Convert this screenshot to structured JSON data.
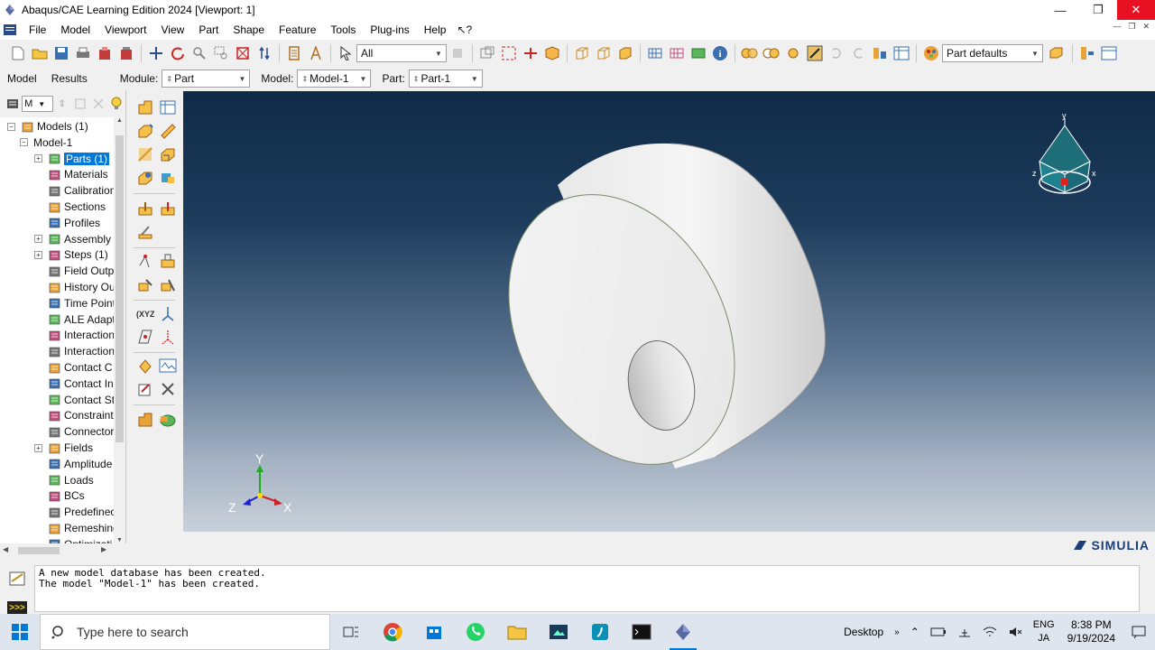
{
  "window": {
    "title": "Abaqus/CAE Learning Edition 2024 [Viewport: 1]"
  },
  "menubar": {
    "items": [
      "File",
      "Model",
      "Viewport",
      "View",
      "Part",
      "Shape",
      "Feature",
      "Tools",
      "Plug-ins",
      "Help"
    ],
    "whats_this": "↖?"
  },
  "toolbar": {
    "selection_filter": "All",
    "render_style": "Part defaults"
  },
  "context": {
    "tabs": [
      "Model",
      "Results"
    ],
    "module_label": "Module:",
    "module_value": "Part",
    "model_label": "Model:",
    "model_value": "Model-1",
    "part_label": "Part:",
    "part_value": "Part-1"
  },
  "tree": {
    "filter": "M",
    "items": [
      {
        "label": "Models (1)",
        "level": 0,
        "expander": "−",
        "icon": "models-icon"
      },
      {
        "label": "Model-1",
        "level": 1,
        "expander": "−",
        "icon": ""
      },
      {
        "label": "Parts (1)",
        "level": 2,
        "expander": "+",
        "icon": "parts-icon",
        "selected": true
      },
      {
        "label": "Materials",
        "level": 2,
        "expander": "",
        "icon": "materials-icon"
      },
      {
        "label": "Calibration",
        "level": 2,
        "expander": "",
        "icon": "calibration-icon"
      },
      {
        "label": "Sections",
        "level": 2,
        "expander": "",
        "icon": "sections-icon"
      },
      {
        "label": "Profiles",
        "level": 2,
        "expander": "",
        "icon": "profiles-icon"
      },
      {
        "label": "Assembly",
        "level": 2,
        "expander": "+",
        "icon": "assembly-icon"
      },
      {
        "label": "Steps (1)",
        "level": 2,
        "expander": "+",
        "icon": "steps-icon"
      },
      {
        "label": "Field Outp",
        "level": 2,
        "expander": "",
        "icon": "field-output-icon"
      },
      {
        "label": "History Ou",
        "level": 2,
        "expander": "",
        "icon": "history-output-icon"
      },
      {
        "label": "Time Point",
        "level": 2,
        "expander": "",
        "icon": "time-points-icon"
      },
      {
        "label": "ALE Adapt",
        "level": 2,
        "expander": "",
        "icon": "ale-adaptive-icon"
      },
      {
        "label": "Interaction",
        "level": 2,
        "expander": "",
        "icon": "interaction-icon"
      },
      {
        "label": "Interaction",
        "level": 2,
        "expander": "",
        "icon": "interaction-props-icon"
      },
      {
        "label": "Contact C",
        "level": 2,
        "expander": "",
        "icon": "contact-controls-icon"
      },
      {
        "label": "Contact In",
        "level": 2,
        "expander": "",
        "icon": "contact-init-icon"
      },
      {
        "label": "Contact St",
        "level": 2,
        "expander": "",
        "icon": "contact-stab-icon"
      },
      {
        "label": "Constraint",
        "level": 2,
        "expander": "",
        "icon": "constraint-icon"
      },
      {
        "label": "Connector",
        "level": 2,
        "expander": "",
        "icon": "connector-icon"
      },
      {
        "label": "Fields",
        "level": 2,
        "expander": "+",
        "icon": "fields-icon"
      },
      {
        "label": "Amplitude",
        "level": 2,
        "expander": "",
        "icon": "amplitude-icon"
      },
      {
        "label": "Loads",
        "level": 2,
        "expander": "",
        "icon": "loads-icon"
      },
      {
        "label": "BCs",
        "level": 2,
        "expander": "",
        "icon": "bcs-icon"
      },
      {
        "label": "Predefinec",
        "level": 2,
        "expander": "",
        "icon": "predefined-icon"
      },
      {
        "label": "Remeshing",
        "level": 2,
        "expander": "",
        "icon": "remeshing-icon"
      },
      {
        "label": "Optimizati",
        "level": 2,
        "expander": "",
        "icon": "optimization-icon"
      }
    ]
  },
  "viewport": {
    "triad_labels": {
      "x": "X",
      "y": "Y",
      "z": "Z"
    },
    "view_cube_labels": {
      "x": "x",
      "y": "y",
      "z": "z"
    }
  },
  "branding": {
    "simulia": "SIMULIA"
  },
  "messages": [
    "A new model database has been created.",
    "The model \"Model-1\" has been created."
  ],
  "prompt_icon": ">>>",
  "taskbar": {
    "search_placeholder": "Type here to search",
    "desktop_label": "Desktop",
    "lang_top": "ENG",
    "lang_bottom": "JA",
    "time": "8:38 PM",
    "date": "9/19/2024"
  },
  "colors": {
    "accent": "#0078d7",
    "close": "#e81123",
    "viewport_top": "#0e2a47",
    "viewport_bottom": "#c8d0da"
  }
}
